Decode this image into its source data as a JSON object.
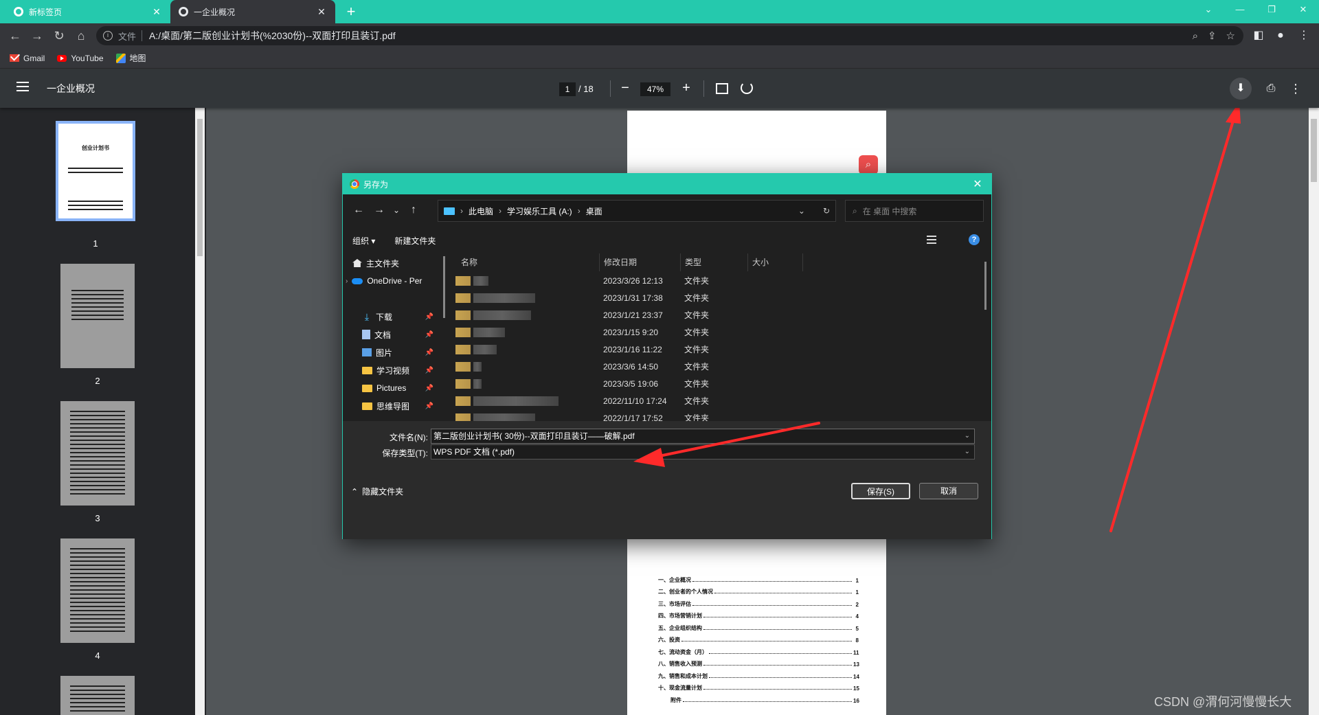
{
  "browser": {
    "tabs": [
      {
        "title": "新标签页"
      },
      {
        "title": "一企业概况"
      }
    ],
    "address": {
      "scheme": "文件",
      "url": "A:/桌面/第二版创业计划书(%2030份)--双面打印且装订.pdf"
    },
    "bookmarks": [
      {
        "label": "Gmail",
        "icon": "gmail-icon"
      },
      {
        "label": "YouTube",
        "icon": "youtube-icon"
      },
      {
        "label": "地图",
        "icon": "maps-icon"
      }
    ]
  },
  "pdf": {
    "title": "一企业概况",
    "page_current": "1",
    "page_total": "/ 18",
    "zoom": "47%",
    "thumbnails": [
      {
        "number": "1",
        "heading": "创业计划书"
      },
      {
        "number": "2"
      },
      {
        "number": "3"
      },
      {
        "number": "4"
      }
    ],
    "toc": [
      {
        "title": "一、企业概况",
        "page": "1"
      },
      {
        "title": "二、创业者的个人情况",
        "page": "1"
      },
      {
        "title": "三、市场评估",
        "page": "2"
      },
      {
        "title": "四、市场营销计划",
        "page": "4"
      },
      {
        "title": "五、企业组织结构",
        "page": "5"
      },
      {
        "title": "六、投资",
        "page": "8"
      },
      {
        "title": "七、流动资金（月）",
        "page": "11"
      },
      {
        "title": "八、销售收入预测",
        "page": "13"
      },
      {
        "title": "九、销售和成本计划",
        "page": "14"
      },
      {
        "title": "十、现金流量计划",
        "page": "15"
      },
      {
        "title": "附件",
        "page": "16"
      }
    ]
  },
  "dialog": {
    "title": "另存为",
    "breadcrumb": [
      "此电脑",
      "学习娱乐工具 (A:)",
      "桌面"
    ],
    "search_placeholder": "在 桌面 中搜索",
    "organize": "组织 ▾",
    "new_folder": "新建文件夹",
    "nav_items": [
      {
        "label": "主文件夹",
        "icon": "home-icon"
      },
      {
        "label": "OneDrive - Per",
        "icon": "cloud-icon"
      },
      {
        "label": "下载",
        "icon": "download-icon"
      },
      {
        "label": "文档",
        "icon": "document-icon"
      },
      {
        "label": "图片",
        "icon": "picture-icon"
      },
      {
        "label": "学习视频",
        "icon": "folder-icon"
      },
      {
        "label": "Pictures",
        "icon": "folder-icon"
      },
      {
        "label": "思维导图",
        "icon": "folder-icon"
      }
    ],
    "columns": [
      "名称",
      "修改日期",
      "类型",
      "大小"
    ],
    "files": [
      {
        "date": "2023/3/26 12:13",
        "type": "文件夹"
      },
      {
        "date": "2023/1/31 17:38",
        "type": "文件夹"
      },
      {
        "date": "2023/1/21 23:37",
        "type": "文件夹"
      },
      {
        "date": "2023/1/15 9:20",
        "type": "文件夹"
      },
      {
        "date": "2023/1/16 11:22",
        "type": "文件夹"
      },
      {
        "date": "2023/3/6 14:50",
        "type": "文件夹"
      },
      {
        "date": "2023/3/5 19:06",
        "type": "文件夹"
      },
      {
        "date": "2022/11/10 17:24",
        "type": "文件夹"
      },
      {
        "date": "2022/1/17 17:52",
        "type": "文件夹"
      }
    ],
    "filename_label": "文件名(N):",
    "filename_value": "第二版创业计划书( 30份)--双面打印且装订——破解.pdf",
    "filetype_label": "保存类型(T):",
    "filetype_value": "WPS PDF 文档 (*.pdf)",
    "hide_folders": "隐藏文件夹",
    "save": "保存(S)",
    "cancel": "取消"
  },
  "watermark": "CSDN @渭何河慢慢长大",
  "colors": {
    "tab_accent": "#25c9ad",
    "annotation": "#ff2a2a"
  }
}
